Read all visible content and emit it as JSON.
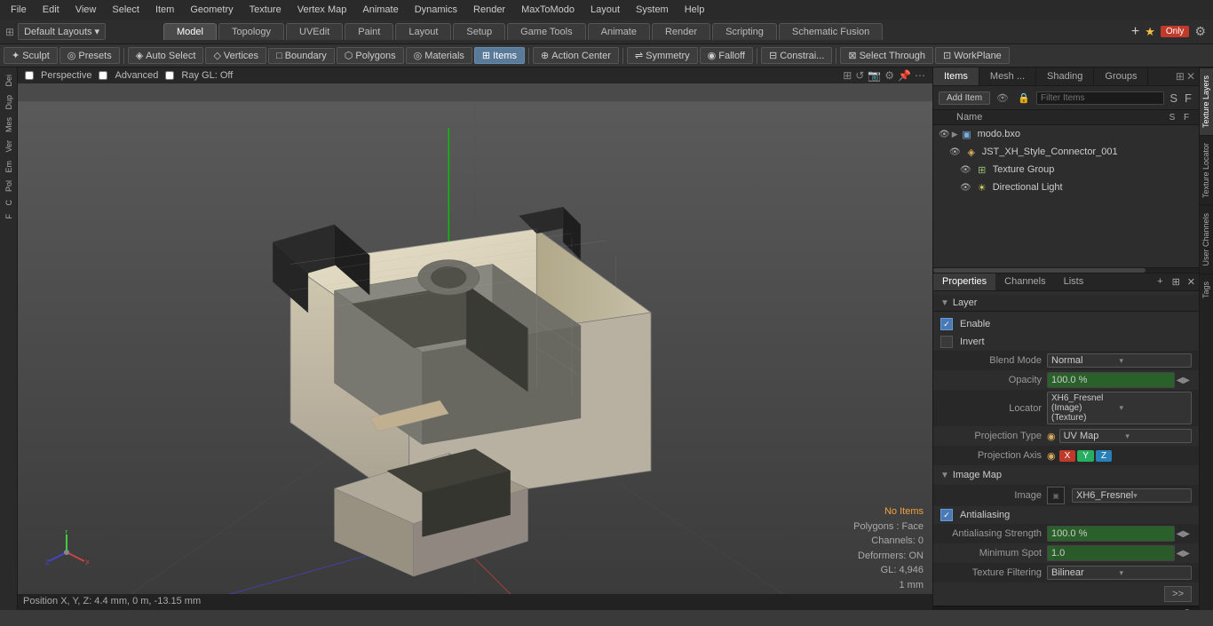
{
  "menuBar": {
    "items": [
      "File",
      "Edit",
      "View",
      "Select",
      "Item",
      "Geometry",
      "Texture",
      "Vertex Map",
      "Animate",
      "Dynamics",
      "Render",
      "MaxToModo",
      "Layout",
      "System",
      "Help"
    ]
  },
  "layoutDropdown": {
    "label": "Default Layouts ▾"
  },
  "topTabs": [
    {
      "id": "model",
      "label": "Model",
      "active": true
    },
    {
      "id": "topology",
      "label": "Topology",
      "active": false
    },
    {
      "id": "uvEdit",
      "label": "UVEdit",
      "active": false
    },
    {
      "id": "paint",
      "label": "Paint",
      "active": false
    },
    {
      "id": "layout",
      "label": "Layout",
      "active": false
    },
    {
      "id": "setup",
      "label": "Setup",
      "active": false
    },
    {
      "id": "gameTools",
      "label": "Game Tools",
      "active": false
    },
    {
      "id": "animate",
      "label": "Animate",
      "active": false
    },
    {
      "id": "render",
      "label": "Render",
      "active": false
    },
    {
      "id": "scripting",
      "label": "Scripting",
      "active": false
    },
    {
      "id": "schematicFusion",
      "label": "Schematic Fusion",
      "active": false
    }
  ],
  "topRight": {
    "addIcon": "+",
    "starIcon": "★",
    "onlyLabel": "Only"
  },
  "secondToolbar": {
    "tools": [
      {
        "id": "sculpt",
        "label": "Sculpt",
        "active": false
      },
      {
        "id": "presets",
        "label": "Presets",
        "active": false
      },
      {
        "id": "autoSelect",
        "label": "Auto Select",
        "icon": "◈",
        "active": false
      },
      {
        "id": "vertices",
        "label": "Vertices",
        "icon": "◇",
        "active": false
      },
      {
        "id": "boundary",
        "label": "Boundary",
        "icon": "□",
        "active": false
      },
      {
        "id": "polygons",
        "label": "Polygons",
        "icon": "⬡",
        "active": false
      },
      {
        "id": "materials",
        "label": "Materials",
        "icon": "◎",
        "active": false
      },
      {
        "id": "items",
        "label": "Items",
        "icon": "⊞",
        "active": true
      },
      {
        "id": "actionCenter",
        "label": "Action Center",
        "icon": "⊕",
        "active": false
      },
      {
        "id": "symmetry",
        "label": "Symmetry",
        "active": false
      },
      {
        "id": "falloff",
        "label": "Falloff",
        "icon": "◉",
        "active": false
      },
      {
        "id": "constrain",
        "label": "Constrai...",
        "active": false
      },
      {
        "id": "selectThrough",
        "label": "Select Through",
        "active": false
      },
      {
        "id": "workPlane",
        "label": "WorkPlane",
        "icon": "⊡",
        "active": false
      }
    ]
  },
  "viewport": {
    "labels": [
      "Perspective",
      "Advanced",
      "Ray GL: Off"
    ],
    "modelInfo": {
      "noItems": "No Items",
      "polygons": "Polygons : Face",
      "channels": "Channels: 0",
      "deformers": "Deformers: ON",
      "gl": "GL: 4,946",
      "mm": "1 mm"
    },
    "statusBar": "Position X, Y, Z:  4.4 mm, 0 m, -13.15 mm"
  },
  "panelTabs": [
    {
      "id": "items",
      "label": "Items",
      "active": true
    },
    {
      "id": "meshMap",
      "label": "Mesh ...",
      "active": false
    },
    {
      "id": "shading",
      "label": "Shading",
      "active": false
    },
    {
      "id": "groups",
      "label": "Groups",
      "active": false
    }
  ],
  "itemsToolbar": {
    "addItemLabel": "Add Item",
    "filterPlaceholder": "Filter Items"
  },
  "itemsTree": {
    "columns": {
      "name": "Name",
      "s": "S",
      "f": "F"
    },
    "rows": [
      {
        "id": "modo-bxo",
        "label": "modo.bxo",
        "indent": 0,
        "icon": "▣",
        "type": "mesh",
        "expanded": true,
        "hasEye": true
      },
      {
        "id": "jst-connector",
        "label": "JST_XH_Style_Connector_001",
        "indent": 1,
        "icon": "◈",
        "type": "item",
        "expanded": false,
        "hasEye": true
      },
      {
        "id": "texture-group",
        "label": "Texture Group",
        "indent": 2,
        "icon": "⊞",
        "type": "group",
        "expanded": false,
        "hasEye": true
      },
      {
        "id": "directional-light",
        "label": "Directional Light",
        "indent": 2,
        "icon": "☀",
        "type": "light",
        "expanded": false,
        "hasEye": true
      }
    ]
  },
  "propertiesTabs": [
    {
      "id": "properties",
      "label": "Properties",
      "active": true
    },
    {
      "id": "channels",
      "label": "Channels",
      "active": false
    },
    {
      "id": "lists",
      "label": "Lists",
      "active": false
    }
  ],
  "properties": {
    "sectionLabel": "Layer",
    "enableLabel": "Enable",
    "enableChecked": true,
    "invertLabel": "Invert",
    "invertChecked": false,
    "blendModeLabel": "Blend Mode",
    "blendModeValue": "Normal",
    "opacityLabel": "Opacity",
    "opacityValue": "100.0 %",
    "locatorLabel": "Locator",
    "locatorValue": "XH6_Fresnel (Image) (Texture)",
    "projectionTypeLabel": "Projection Type",
    "projectionTypeIcon": "◉",
    "projectionTypeValue": "UV Map",
    "projectionAxisLabel": "Projection Axis",
    "projectionAxisX": "X",
    "projectionAxisY": "Y",
    "projectionAxisZ": "Z",
    "imageMapLabel": "Image Map",
    "imageLabel": "Image",
    "imageValue": "XH6_Fresnel",
    "antialiasingLabel": "Antialiasing",
    "antialiasingChecked": true,
    "antialiasingStrengthLabel": "Antialiasing Strength",
    "antialiasingStrengthValue": "100.0 %",
    "minimumSpotLabel": "Minimum Spot",
    "minimumSpotValue": "1.0",
    "textureFilteringLabel": "Texture Filtering",
    "textureFilteringValue": "Bilinear"
  },
  "rightSideTabs": [
    {
      "id": "texture-layers",
      "label": "Texture Layers",
      "active": true
    },
    {
      "id": "texture-locator",
      "label": "Texture Locator",
      "active": false
    },
    {
      "id": "user-channels",
      "label": "User Channels",
      "active": false
    },
    {
      "id": "tags",
      "label": "Tags",
      "active": false
    }
  ],
  "leftSidebar": {
    "items": [
      "Dei",
      "Dup",
      "Mes",
      "Ver",
      "Em",
      "Pol",
      "C",
      "F"
    ]
  }
}
